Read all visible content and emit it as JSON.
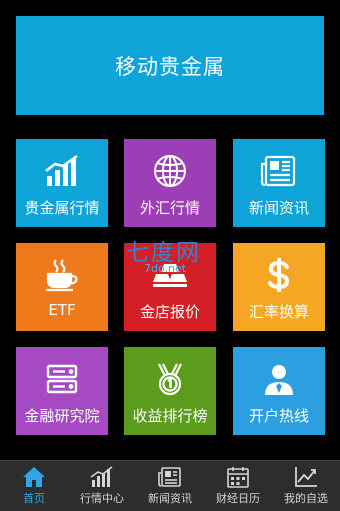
{
  "banner": {
    "title": "移动贵金属",
    "color": "#0fa4d8"
  },
  "tiles": [
    {
      "label": "贵金属行情",
      "icon": "bar-chart-icon",
      "color": "#0fa4d8"
    },
    {
      "label": "外汇行情",
      "icon": "globe-icon",
      "color": "#9c3fb6"
    },
    {
      "label": "新闻资讯",
      "icon": "newspaper-icon",
      "color": "#0fa4d8"
    },
    {
      "label": "ETF",
      "icon": "coffee-cup-icon",
      "color": "#ee7a1b"
    },
    {
      "label": "金店报价",
      "icon": "gold-bars-icon",
      "color": "#d41f26"
    },
    {
      "label": "汇率换算",
      "icon": "dollar-icon",
      "color": "#f5a623"
    },
    {
      "label": "金融研究院",
      "icon": "server-icon",
      "color": "#a54ac3"
    },
    {
      "label": "收益排行榜",
      "icon": "medal-icon",
      "color": "#5b9c1d"
    },
    {
      "label": "开户热线",
      "icon": "person-icon",
      "color": "#2c9fe0"
    }
  ],
  "watermark": {
    "text": "七度网",
    "url": "7do.net"
  },
  "tabbar": {
    "active_color": "#2fa6e8",
    "tabs": [
      {
        "label": "首页",
        "icon": "home-icon",
        "active": true
      },
      {
        "label": "行情中心",
        "icon": "chart-icon",
        "active": false
      },
      {
        "label": "新闻资讯",
        "icon": "newspaper-icon",
        "active": false
      },
      {
        "label": "财经日历",
        "icon": "calendar-icon",
        "active": false
      },
      {
        "label": "我的自选",
        "icon": "trend-icon",
        "active": false
      }
    ]
  }
}
